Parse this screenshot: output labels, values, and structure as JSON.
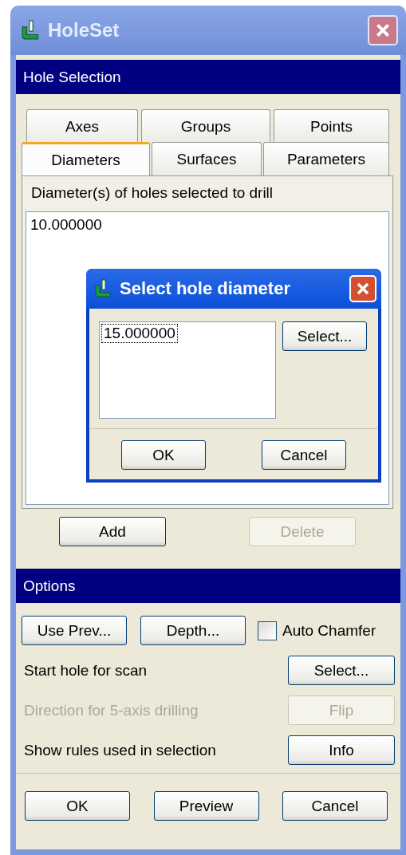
{
  "window": {
    "title": "HoleSet",
    "active": false
  },
  "hole_selection": {
    "title": "Hole Selection",
    "tab_rows": [
      [
        {
          "label": "Axes",
          "selected": false
        },
        {
          "label": "Groups",
          "selected": false
        },
        {
          "label": "Points",
          "selected": false
        }
      ],
      [
        {
          "label": "Diameters",
          "selected": true
        },
        {
          "label": "Surfaces",
          "selected": false
        },
        {
          "label": "Parameters",
          "selected": false
        }
      ]
    ],
    "list_label": "Diameter(s) of holes selected to drill",
    "list_items": [
      {
        "text": "10.000000",
        "focused": false
      }
    ],
    "buttons": [
      {
        "label": "Add",
        "disabled": false
      },
      {
        "label": "Delete",
        "disabled": true
      }
    ]
  },
  "options": {
    "title": "Options",
    "top_buttons": [
      {
        "label": "Use Prev...",
        "disabled": false
      },
      {
        "label": "Depth...",
        "disabled": false
      }
    ],
    "auto_chamfer": {
      "label": "Auto Chamfer",
      "checked": false
    },
    "rows": [
      {
        "label": "Start hole for scan",
        "button": "Select...",
        "disabled": false
      },
      {
        "label": "Direction for 5-axis drilling",
        "button": "Flip",
        "disabled": true
      },
      {
        "label": "Show rules used in selection",
        "button": "Info",
        "disabled": false
      }
    ]
  },
  "footer_buttons": [
    {
      "label": "OK",
      "disabled": false
    },
    {
      "label": "Preview",
      "disabled": false
    },
    {
      "label": "Cancel",
      "disabled": false
    }
  ],
  "dialog": {
    "title": "Select hole diameter",
    "active": true,
    "list_items": [
      {
        "text": "15.000000",
        "focused": true
      }
    ],
    "select_button": "Select...",
    "buttons": [
      {
        "label": "OK",
        "disabled": false
      },
      {
        "label": "Cancel",
        "disabled": false
      }
    ]
  }
}
